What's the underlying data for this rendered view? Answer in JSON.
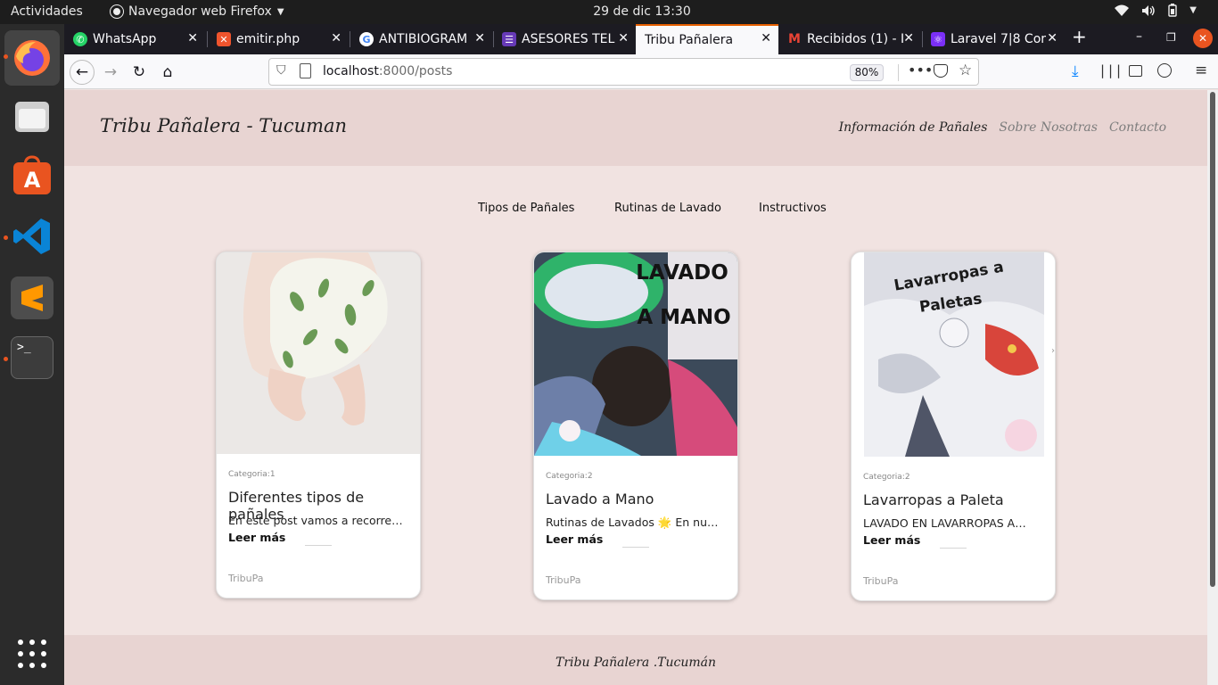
{
  "topbar": {
    "activities": "Actividades",
    "app_name": "Navegador web Firefox",
    "clock": "29 de dic  13:30"
  },
  "tabs": [
    {
      "label": "WhatsApp",
      "favicon_color": "#25d366"
    },
    {
      "label": "emitir.php",
      "favicon_color": "#f0542d"
    },
    {
      "label": "ANTIBIOGRAM",
      "favicon_color": "#ffffff"
    },
    {
      "label": "ASESORES TEL",
      "favicon_color": "#673ab7"
    },
    {
      "label": "Tribu Pañalera",
      "favicon_color": ""
    },
    {
      "label": "Recibidos (1) - I",
      "favicon_color": "#ea4335"
    },
    {
      "label": "Laravel 7|8 Cor",
      "favicon_color": "#7b2ff7"
    }
  ],
  "address_bar": {
    "host": "localhost",
    "rest": ":8000/posts",
    "zoom": "80%"
  },
  "site": {
    "brand": "Tribu Pañalera - Tucuman",
    "menu": [
      "Información de Pañales",
      "Sobre Nosotras",
      "Contacto"
    ],
    "categories": [
      "Tipos de Pañales",
      "Rutinas de Lavado",
      "Instructivos"
    ],
    "footer": "Tribu Pañalera .Tucumán"
  },
  "posts": [
    {
      "category": "Categoria:1",
      "title": "Diferentes tipos de pañales",
      "excerpt": "En este post vamos a recorre…",
      "read_more": "Leer más",
      "author": "TribuPa"
    },
    {
      "category": "Categoria:2",
      "title": "Lavado a Mano",
      "excerpt": "Rutinas de Lavados 🌟 En nu…",
      "read_more": "Leer más",
      "author": "TribuPa",
      "image_text": [
        "LAVADO",
        "A MANO"
      ]
    },
    {
      "category": "Categoria:2",
      "title": "Lavarropas a Paleta",
      "excerpt": "LAVADO EN LAVARROPAS A…",
      "read_more": "Leer más",
      "author": "TribuPa",
      "image_text": [
        "Lavarropas a",
        "Paletas"
      ]
    }
  ],
  "colors": {
    "header_bg": "#e8d4d2",
    "page_bg": "#f1e3e1",
    "active_tab_accent": "#e66000"
  }
}
